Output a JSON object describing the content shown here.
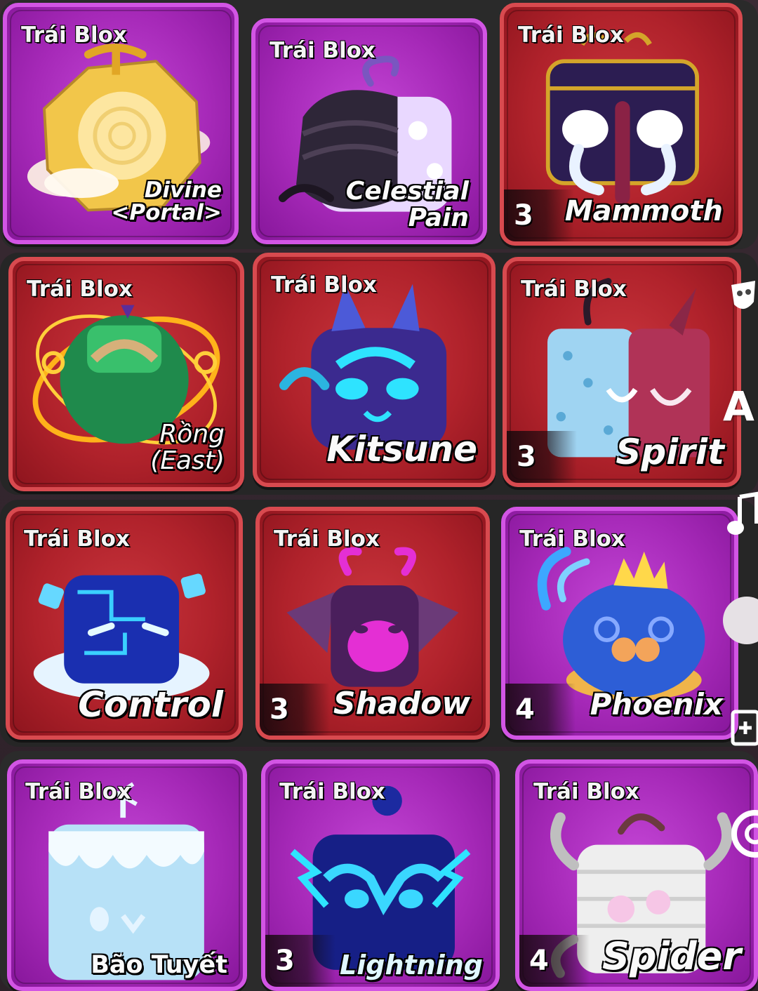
{
  "cards": [
    {
      "type": "Trái Blox",
      "name": "Divine\n<Portal>",
      "count": "",
      "rarity": "purple"
    },
    {
      "type": "Trái Blox",
      "name": "Celestial\nPain",
      "count": "",
      "rarity": "purple"
    },
    {
      "type": "Trái Blox",
      "name": "Mammoth",
      "count": "3",
      "rarity": "red"
    },
    {
      "type": "Trái Blox",
      "name": "Rồng\n(East)",
      "count": "",
      "rarity": "red"
    },
    {
      "type": "Trái Blox",
      "name": "Kitsune",
      "count": "",
      "rarity": "red"
    },
    {
      "type": "Trái Blox",
      "name": "Spirit",
      "count": "3",
      "rarity": "red"
    },
    {
      "type": "Trái Blox",
      "name": "Control",
      "count": "",
      "rarity": "red"
    },
    {
      "type": "Trái Blox",
      "name": "Shadow",
      "count": "3",
      "rarity": "red"
    },
    {
      "type": "Trái Blox",
      "name": "Phoenix",
      "count": "4",
      "rarity": "purple"
    },
    {
      "type": "Trái Blox",
      "name": "Bão Tuyết",
      "count": "",
      "rarity": "purple"
    },
    {
      "type": "Trái Blox",
      "name": "Lightning",
      "count": "3",
      "rarity": "purple"
    },
    {
      "type": "Trái Blox",
      "name": "Spider",
      "count": "4",
      "rarity": "purple"
    }
  ],
  "side_icons": [
    "masks-icon",
    "text-icon",
    "music-icon",
    "circle-icon",
    "add-icon",
    "ring-icon"
  ],
  "side_text": {
    "text_icon": "A"
  },
  "colors": {
    "purple": "#a629b8",
    "red": "#b0222b"
  }
}
